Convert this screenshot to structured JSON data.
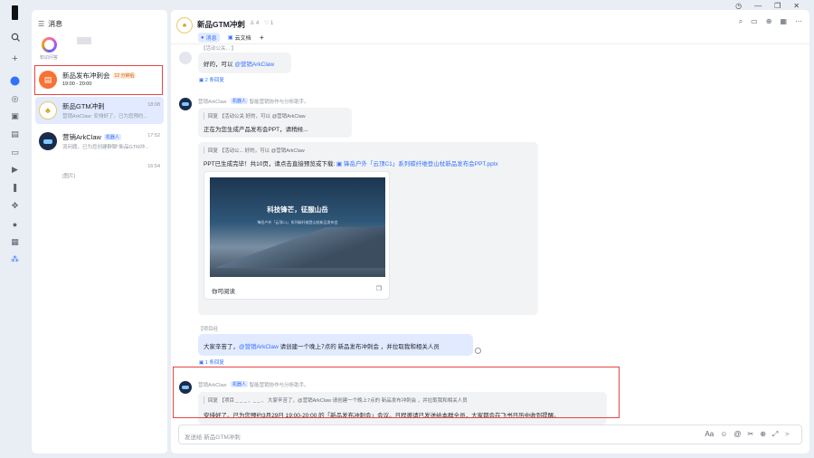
{
  "sidebar_header": {
    "title": "消息"
  },
  "knowledge": {
    "label": "知识问答"
  },
  "conversations": [
    {
      "name": "新品发布冲刺会",
      "tag": "12 分钟后",
      "subtitle": "19:00 - 20:00",
      "time": ""
    },
    {
      "name": "新品GTM冲刺",
      "subtitle": "营销ArkClaw: 安排好了。已为您预约...",
      "time": "18:08"
    },
    {
      "name": "营销ArkClaw",
      "tag": "机器人",
      "subtitle": "流问题，已为您创建群聊\"新品GTM冲...",
      "time": "17:52"
    },
    {
      "name": "",
      "subtitle": "[图片]",
      "time": "16:54"
    }
  ],
  "chat": {
    "title": "新品GTM冲刺",
    "members": "4",
    "likes": "1",
    "tabs": [
      "消息",
      "云文档"
    ],
    "add_tab": "+"
  },
  "messages": {
    "m1_quote_top": "【活动公关... 】",
    "m1_text_prefix": "好的，可以",
    "m1_mention": "@营销ArkClaw",
    "m1_replies": "2 条回复",
    "bot_name": "营销ArkClaw",
    "bot_tag": "机器人",
    "bot_desc": "智能营销协作与分析助手。",
    "m2_quote": "回复 【活动公关          好的，可以 @营销ArkClaw",
    "m2_text": "正在为您生成产品发布会PPT，请稍候...",
    "m3_quote": "回复 【活动公...            好的，可以 @营销ArkClaw",
    "m3_text": "PPT已生成完毕！共10页，请点击直接预览或下载:",
    "m3_file": "锋岳户外「云顶C1」系列碳纤维登山杖新品发布会PPT.pptx",
    "ppt_title": "科技锋芒，征服山岳",
    "ppt_sub": "锋岳户外「云顶C1」系列碳纤维登山杖新品发布会",
    "ppt_footer": "你可阅读",
    "m4_sender": "【项目经",
    "m4_prefix": "大家辛苦了，",
    "m4_mention": "@营销ArkClaw",
    "m4_suffix": " 请创建一个晚上7点的 新品发布冲刺会 ，并拉取我和相关人员",
    "m4_replies": "1 条回复",
    "m5_quote": "回复 【项目 _ _ _ 、_ _ 、   大家辛苦了，@营销ArkClaw 请创建一个晚上7点的 新品发布冲刺会 ，并拉取我和相关人员",
    "m5_text": "安排好了。已为您预约3月29日 19:00-20:00 的「新品发布冲刺会」会议。日程邀请已发送给本群全员，大家都会在飞书日历中收到提醒。"
  },
  "input": {
    "placeholder": "发送给 新品GTM冲刺"
  },
  "colors": {
    "accent": "#3370ff",
    "highlight_box": "#e54545",
    "orange_avatar": "#f77234"
  }
}
